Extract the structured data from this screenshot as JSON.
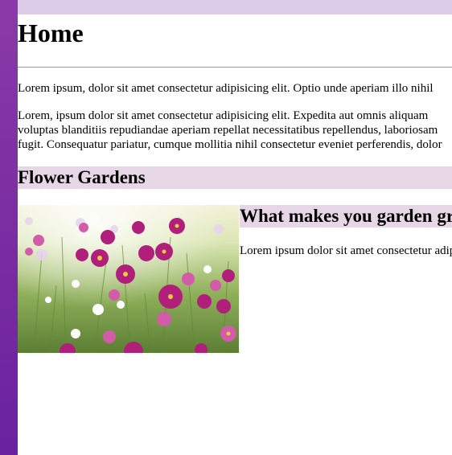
{
  "page": {
    "title": "Home",
    "intro": "Lorem ipsum, dolor sit amet consectetur adipisicing elit. Optio unde aperiam illo nihil",
    "body_lines": [
      "Lorem, ipsum dolor sit amet consectetur adipisicing elit. Expedita aut omnis aliquam",
      "voluptas blanditiis repudiandae aperiam repellat necessitatibus repellendus, laboriosam",
      "fugit. Consequatur pariatur, cumque mollitia nihil consectetur eveniet perferendis, dolor"
    ]
  },
  "section": {
    "heading": "Flower Gardens",
    "image_alt": "flower-field-image",
    "subheading": "What makes you garden grow",
    "text": "Lorem ipsum dolor sit amet consectetur adipisicing"
  },
  "colors": {
    "sidebar": "#7c2fa2",
    "topbar": "#dccbe9",
    "heading_band": "#e7d7e6"
  }
}
